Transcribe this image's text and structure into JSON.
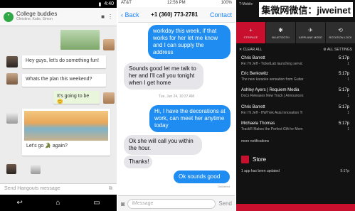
{
  "watermark": "集微网微信：jiweinet",
  "hangouts": {
    "status_time": "4:40",
    "title": "College buddies",
    "subtitle": "Christine, Katie, Simon",
    "messages": [
      {
        "text": "Hey guys, let's do something fun!",
        "meta": "1:40"
      },
      {
        "text": "Whats the plan this weekend?",
        "meta": "1:40"
      },
      {
        "text": "It's going to be 😊",
        "meta": ""
      },
      {
        "text": "Let's go 🐊 again?",
        "meta": "1:40"
      }
    ],
    "input_placeholder": "Send Hangouts message"
  },
  "imessage": {
    "carrier": "AT&T",
    "status_time": "12:56 PM",
    "battery": "100%",
    "back_label": "Back",
    "phone_number": "+1 (360) 773-2781",
    "contact_label": "Contact",
    "bubbles": [
      {
        "text": "workday this week, if that works for her let me know and I can supply the address"
      },
      {
        "text": "Sounds good let me talk to her and I'll call you tonight when I get home"
      },
      {
        "text": "Hi, I have the decorations at work, can meet her anytime today"
      },
      {
        "text": "Ok she will call you within the hour."
      },
      {
        "text": "Thanks!"
      },
      {
        "text": "Ok sounds good"
      }
    ],
    "date_label": "Tue, Jun 24, 10:37 AM",
    "delivered": "Delivered",
    "input_placeholder": "iMessage",
    "send_label": "Send"
  },
  "notifications": {
    "carrier": "T-Mobile",
    "toggles": [
      {
        "label": "STRIPAGE",
        "icon": "+",
        "on": true
      },
      {
        "label": "BLUETOOTH",
        "icon": "✱",
        "on": false
      },
      {
        "label": "AIRPLANE MODE",
        "icon": "✈",
        "on": false
      },
      {
        "label": "ROTATION LOCK",
        "icon": "⟲",
        "on": false
      }
    ],
    "clear_all": "CLEAR ALL",
    "all_settings": "ALL SETTINGS",
    "items": [
      {
        "name": "Chris Barrett",
        "time": "5:17p",
        "preview": "Re: Hi Jeff - TicketLab launching servic",
        "count": "1"
      },
      {
        "name": "Eric Berkowitz",
        "time": "5:17p",
        "preview": "The new karaoke sensation from Guitar",
        "count": "1"
      },
      {
        "name": "Ashley Ayers | Requiem Media",
        "time": "5:17p",
        "preview": "Docs Releases New Track | Announces",
        "count": "1"
      },
      {
        "name": "Chris Barrett",
        "time": "5:17p",
        "preview": "Re: Hi Jeff - HWTrek Asia Innovation Ti",
        "count": "1"
      },
      {
        "name": "Michaela Thomas",
        "time": "5:17p",
        "preview": "TrackR Makes the Perfect Gift for Mom",
        "count": "1"
      }
    ],
    "more_label": "more notifications",
    "store_name": "Store",
    "store_message": "1 app has been updated",
    "store_time": "5:17p"
  }
}
